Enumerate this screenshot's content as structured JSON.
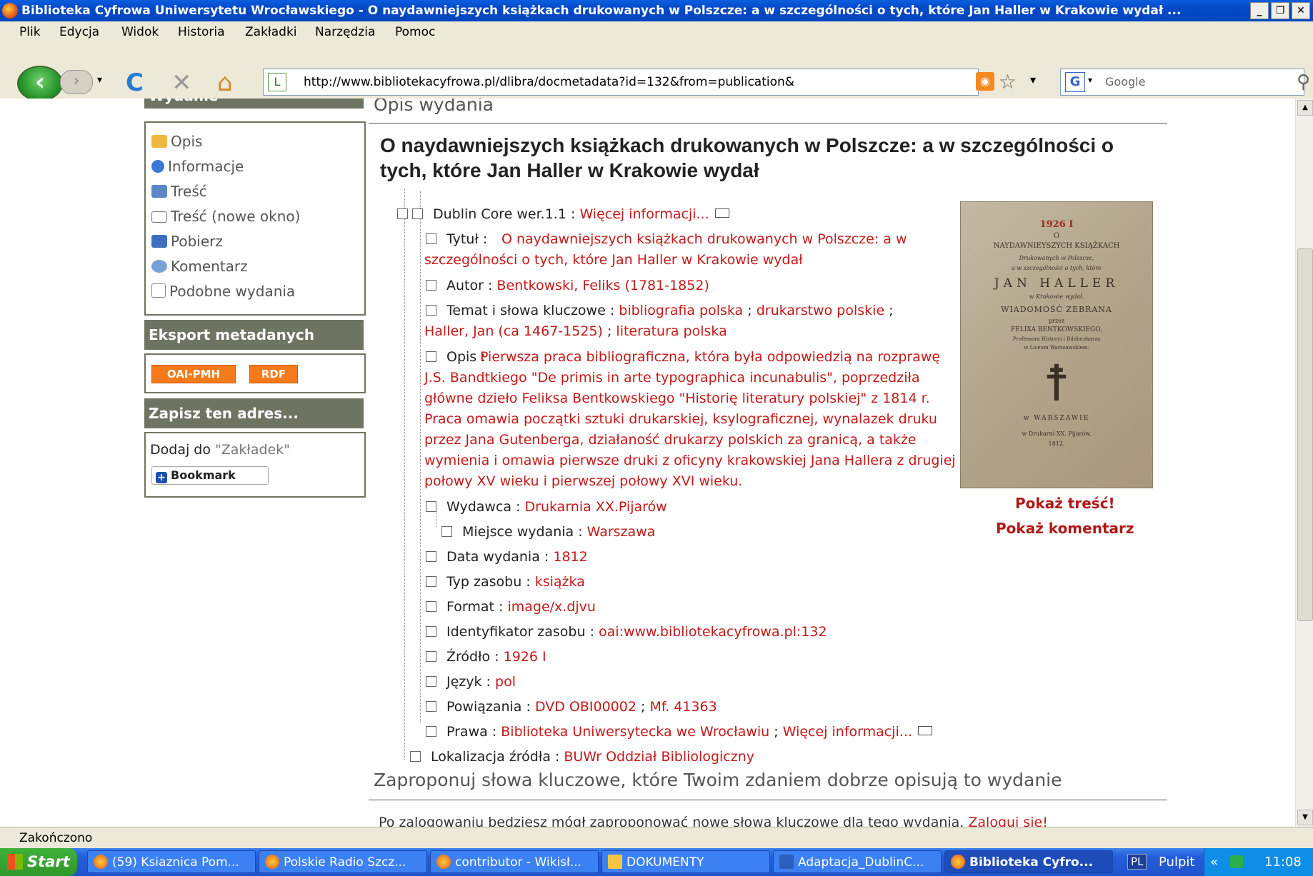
{
  "window": {
    "title": "Biblioteka Cyfrowa Uniwersytetu Wrocławskiego - O naydawniejszych książkach drukowanych w Polszcze: a w szczególności o tych, które Jan Haller w Krakowie wydał ...",
    "min": "_",
    "max": "❐",
    "close": "✕"
  },
  "menu": [
    "Plik",
    "Edycja",
    "Widok",
    "Historia",
    "Zakładki",
    "Narzędzia",
    "Pomoc"
  ],
  "nav": {
    "url": "http://www.bibliotekacyfrowa.pl/dlibra/docmetadata?id=132&from=publication&",
    "search_placeholder": "Google",
    "back": "‹",
    "forward": "›",
    "reload": "C",
    "stop": "✕",
    "home": "⌂",
    "star": "☆",
    "dropdown": "▾"
  },
  "sidebar": {
    "wydanie_header": "Wydanie",
    "items": [
      {
        "label": "Opis",
        "icon": "description-icon",
        "color": "#f2b73d"
      },
      {
        "label": "Informacje",
        "icon": "info-icon",
        "color": "#3a78d4"
      },
      {
        "label": "Treść",
        "icon": "book-icon",
        "color": "#5b87c6"
      },
      {
        "label": "Treść (nowe okno)",
        "icon": "new-window-icon",
        "color": "#777777"
      },
      {
        "label": "Pobierz",
        "icon": "save-icon",
        "color": "#3a6fc2"
      },
      {
        "label": "Komentarz",
        "icon": "comment-icon",
        "color": "#7aa0d8"
      },
      {
        "label": "Podobne wydania",
        "icon": "similar-icon",
        "color": "#8a8a8a"
      }
    ],
    "export_header": "Eksport metadanych",
    "export_buttons": [
      "OAI-PMH",
      "RDF"
    ],
    "save_header": "Zapisz ten adres...",
    "add_prefix": "Dodaj do ",
    "add_link": "\"Zakładek\"",
    "bookmark_label": "Bookmark",
    "bookmark_plus": "+"
  },
  "main": {
    "section_title": "Opis wydania",
    "pub_title": "O naydawniejszych książkach drukowanych w Polszcze: a w szczególności o tych, które Jan Haller w Krakowie wydał",
    "dc_label": "Dublin Core wer.1.1 :",
    "dc_more": "Więcej informacji...",
    "title_label": "Tytuł :",
    "title_value": "O naydawniejszych książkach drukowanych w Polszcze: a w szczególności o tych, które Jan Haller w Krakowie wydał",
    "author_label": "Autor :",
    "author_value": "Bentkowski, Feliks (1781-1852)",
    "subject_label": "Temat i słowa kluczowe :",
    "subject_1": "bibliografia polska",
    "subject_2": "drukarstwo polskie",
    "subject_3": "Haller, Jan (ca 1467-1525)",
    "subject_4": "literatura polska",
    "sep": ";",
    "desc_label": "Opis :",
    "desc_value": "Pierwsza praca bibliograficzna, która była odpowiedzią na rozprawę J.S. Bandtkiego \"De primis in arte typographica incunabulis\", poprzedziła główne dzieło Feliksa Bentkowskiego \"Historię literatury polskiej\" z 1814 r. Praca omawia początki sztuki drukarskiej, ksylograficznej, wynalazek druku przez Jana Gutenberga, działaność drukarzy polskich za granicą, a także wymienia i omawia pierwsze druki z oficyny krakowskiej Jana Hallera z drugiej połowy XV wieku i pierwszej połowy XVI wieku.",
    "publisher_label": "Wydawca :",
    "publisher_value": "Drukarnia XX.Pijarów",
    "place_label": "Miejsce wydania :",
    "place_value": "Warszawa",
    "date_label": "Data wydania :",
    "date_value": "1812",
    "type_label": "Typ zasobu :",
    "type_value": "książka",
    "format_label": "Format :",
    "format_value": "image/x.djvu",
    "id_label": "Identyfikator zasobu :",
    "id_value": "oai:www.bibliotekacyfrowa.pl:132",
    "source_label": "Źródło :",
    "source_value": "1926 I",
    "lang_label": "Język :",
    "lang_value": "pol",
    "relation_label": "Powiązania :",
    "relation_1": "DVD OBI00002",
    "relation_2": "Mf. 41363",
    "rights_label": "Prawa :",
    "rights_1": "Biblioteka Uniwersytecka we Wrocławiu",
    "rights_2": "Więcej informacji...",
    "location_label": "Lokalizacja źródła :",
    "location_value": "BUWr Oddział Bibliologiczny",
    "keywords_title": "Zaproponuj słowa kluczowe, które Twoim zdaniem dobrze opisują to wydanie",
    "login_text": "Po zalogowaniu będziesz mógł zaproponować nowe słowa kluczowe dla tego wydania.",
    "login_link": "Zaloguj się!",
    "show_content": "Pokaż treść!",
    "show_comment": "Pokaż komentarz"
  },
  "cover": {
    "shelf_mark": "1926 I",
    "line1": "O",
    "line2": "NAYDAWNIEYSZYCH KSIĄŻKACH",
    "line3": "Drukowanych w Polszcze,",
    "line4": "a w szczególności o tych, które",
    "line5": "JAN HALLER",
    "line6": "w Krakowie wydał.",
    "line7": "WIADOMOŚĆ ZEBRANA",
    "line8": "przez",
    "line9": "FELIXA BENTKOWSKIEGO,",
    "line10": "Professora Historyi i Bibliotekarza",
    "line11": "w Liceum Warszawskiem.",
    "emblem": "☨",
    "city": "w WARSZAWIE",
    "printer": "w Drukarni XX. Pijarów,",
    "year": "1812."
  },
  "status": "Zakończono",
  "taskbar": {
    "start": "Start",
    "tasks": [
      "(59) Ksiaznica Pom...",
      "Polskie Radio Szcz...",
      "contributor - Wikisł...",
      "DOKUMENTY",
      "Adaptacja_DublinC...",
      "Biblioteka Cyfro..."
    ],
    "lang": "PL",
    "desktop": "Pulpit",
    "chevron": "»",
    "quick": "«",
    "time": "11:08"
  }
}
